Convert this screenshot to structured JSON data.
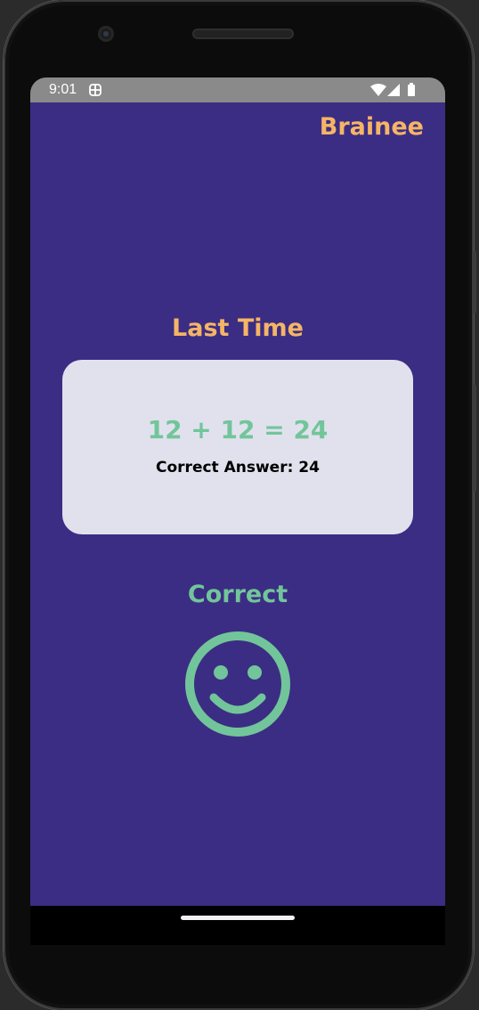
{
  "status_bar": {
    "time": "9:01"
  },
  "app": {
    "brand": "Brainee"
  },
  "main": {
    "section_title": "Last Time",
    "card": {
      "equation": "12 + 12 = 24",
      "correct_answer": "Correct Answer: 24"
    },
    "result": {
      "label": "Correct",
      "icon": "smiley-face-icon"
    }
  },
  "colors": {
    "background": "#3b2d84",
    "brand_orange": "#f5b565",
    "success_green": "#72c59a",
    "card_bg": "#e1e1ee"
  }
}
